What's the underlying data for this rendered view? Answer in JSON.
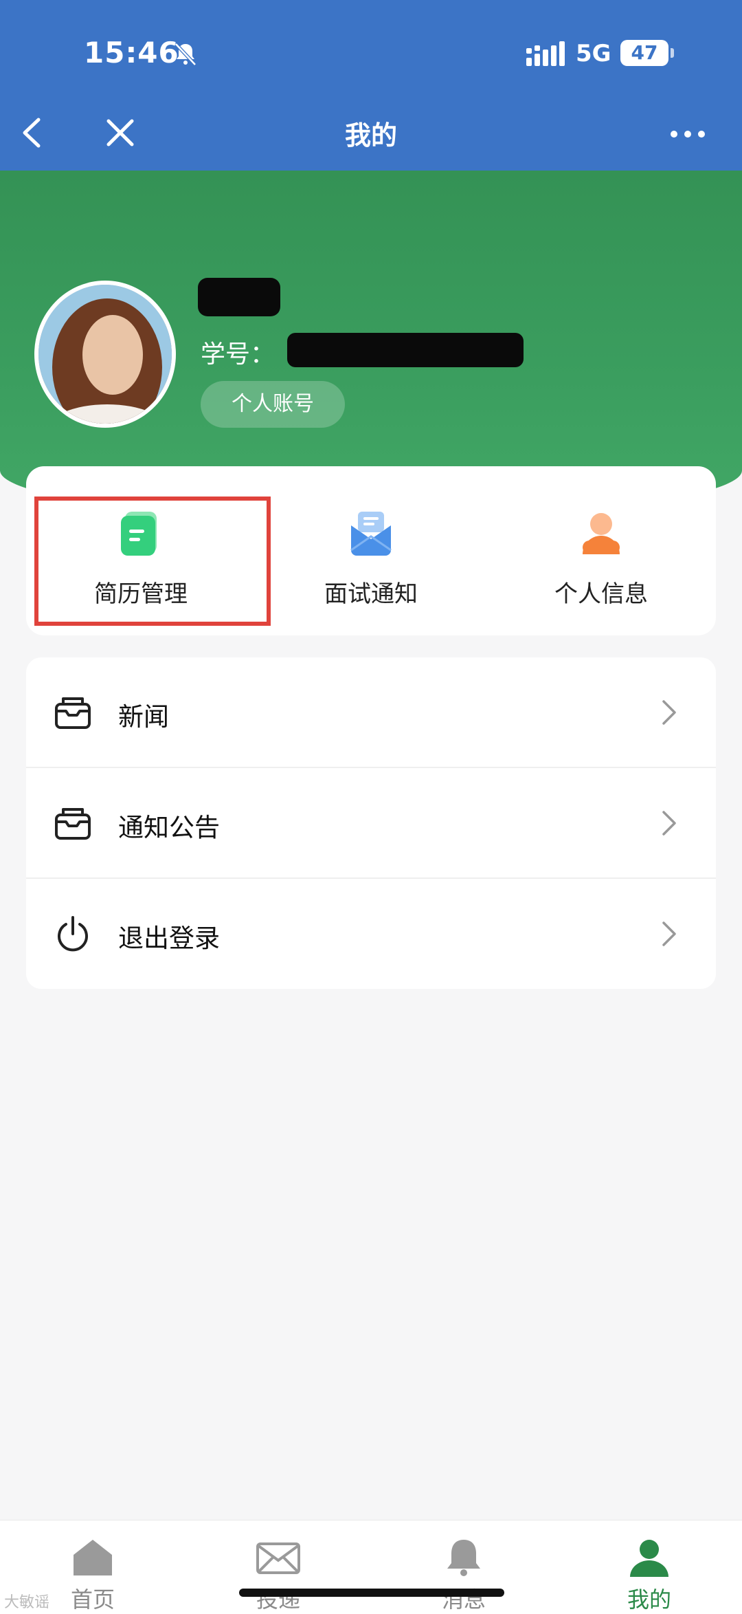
{
  "status_bar": {
    "time": "15:46",
    "network": "5G",
    "battery": "47"
  },
  "nav": {
    "title": "我的"
  },
  "profile": {
    "student_id_label": "学号：",
    "account_chip": "个人账号"
  },
  "features": [
    {
      "label": "简历管理",
      "icon": "resume-icon",
      "color": "#3dd68c"
    },
    {
      "label": "面试通知",
      "icon": "mail-icon",
      "color": "#4a90e8"
    },
    {
      "label": "个人信息",
      "icon": "person-icon",
      "color": "#f5823a"
    }
  ],
  "menu": [
    {
      "label": "新闻",
      "icon": "inbox-icon"
    },
    {
      "label": "通知公告",
      "icon": "inbox-icon"
    },
    {
      "label": "退出登录",
      "icon": "power-icon"
    }
  ],
  "tabs": [
    {
      "label": "首页",
      "icon": "home-icon"
    },
    {
      "label": "投递",
      "icon": "envelope-icon"
    },
    {
      "label": "消息",
      "icon": "bell-icon"
    },
    {
      "label": "我的",
      "icon": "user-icon",
      "active": true
    }
  ],
  "watermark": "大敏谣",
  "colors": {
    "topbar": "#3c74c6",
    "header_green": "#349255",
    "active_tab": "#2b8a49",
    "highlight": "#e0433c"
  }
}
